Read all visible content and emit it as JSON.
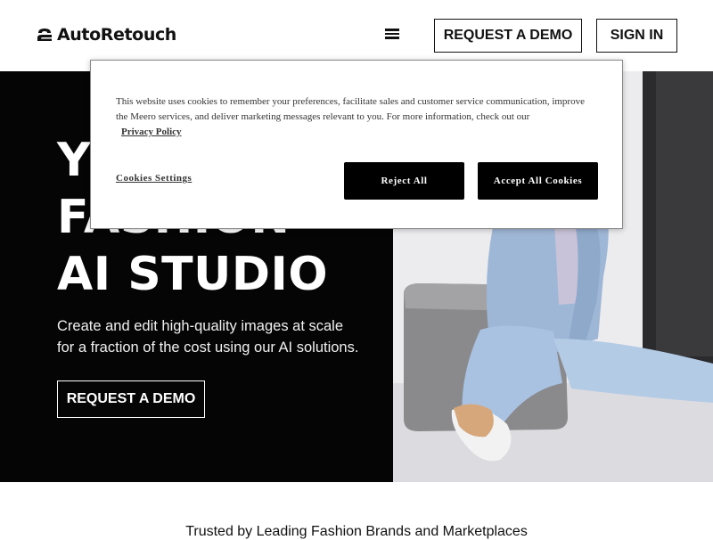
{
  "header": {
    "logo_text": "AutoRetouch",
    "menu_icon": "hamburger-menu-icon",
    "request_demo_label": "REQUEST A DEMO",
    "sign_in_label": "SIGN IN"
  },
  "hero": {
    "title_lines": [
      "Y",
      "FASHION",
      "AI STUDIO"
    ],
    "subtitle_line1": "Create and edit high-quality images at scale",
    "subtitle_line2": "for a fraction of the cost using our AI solutions.",
    "cta_label": "REQUEST A DEMO",
    "image": "model-in-denim-sitting-on-grey-cube-photo"
  },
  "trusted": {
    "text": "Trusted by Leading Fashion Brands and Marketplaces"
  },
  "cookie_banner": {
    "text": "This website uses cookies to remember your preferences, facilitate sales and customer service communication, improve the Meero services, and deliver marketing messages relevant to you. For more information, check out our",
    "privacy_link": "Privacy Policy",
    "settings_label": "Cookies Settings",
    "reject_label": "Reject All",
    "accept_label": "Accept All Cookies"
  }
}
